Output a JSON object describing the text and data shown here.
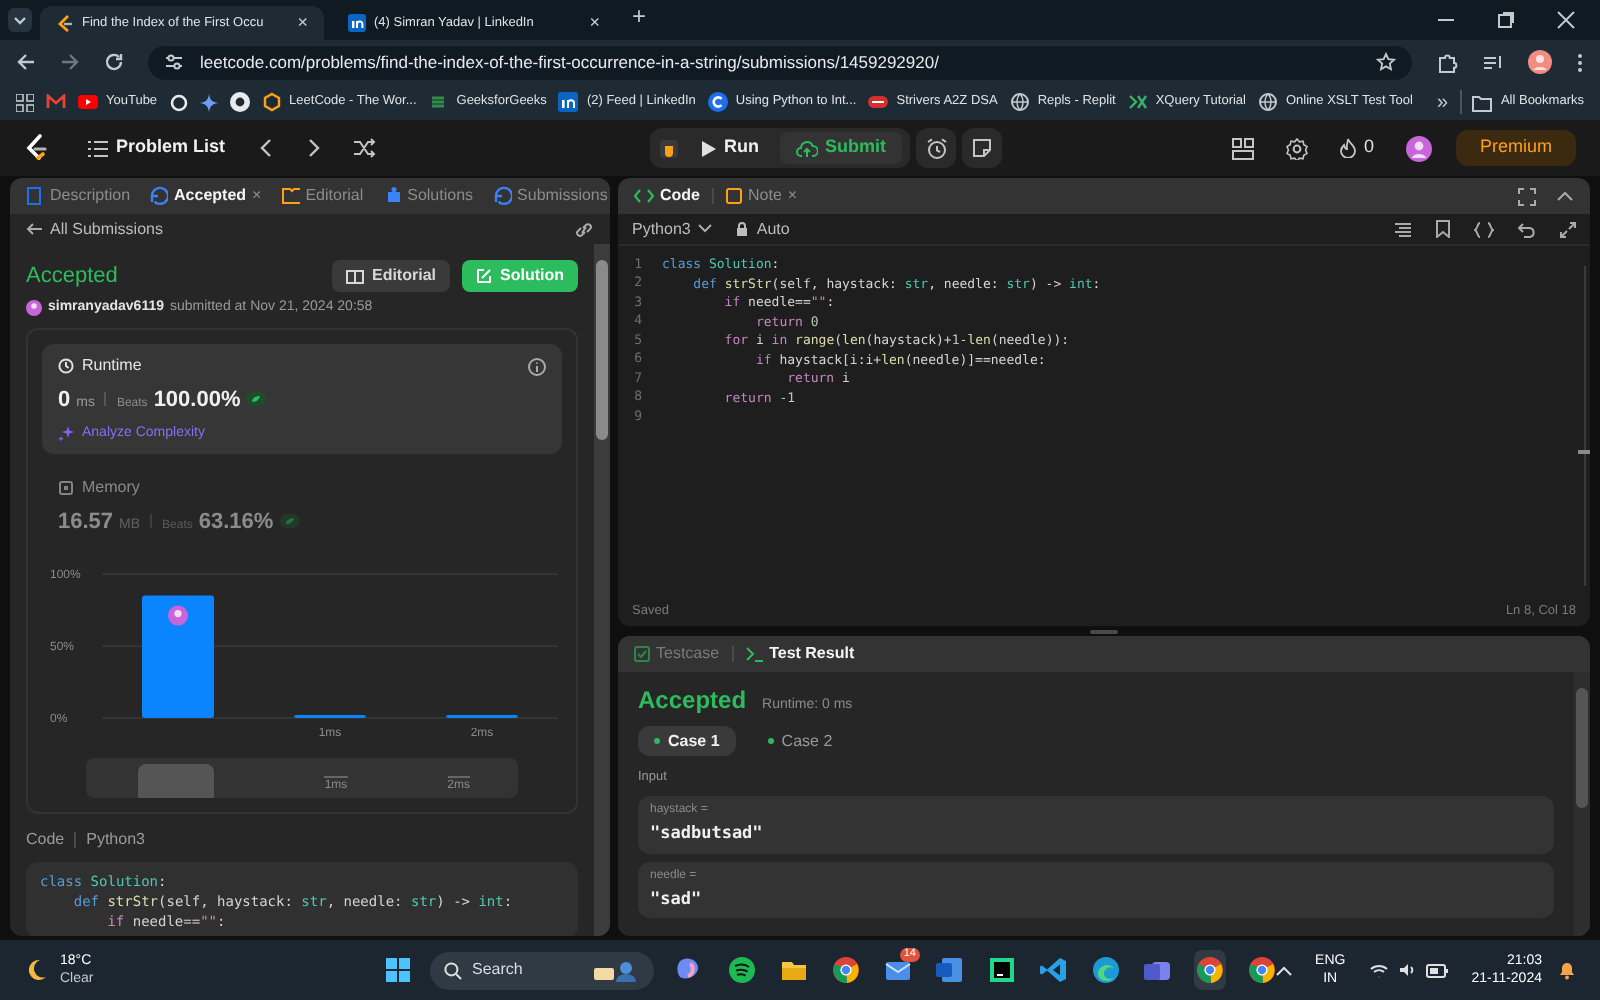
{
  "browser": {
    "tabs": [
      {
        "title": "Find the Index of the First Occu",
        "close": "×",
        "selected": true
      },
      {
        "title": "(4) Simran Yadav | LinkedIn",
        "close": "×",
        "selected": false
      }
    ],
    "new_tab": "+",
    "url": "leetcode.com/problems/find-the-index-of-the-first-occurrence-in-a-string/submissions/1459292920/",
    "bookmarks": [
      {
        "label": "YouTube"
      },
      {
        "label": "LeetCode - The Wor..."
      },
      {
        "label": "GeeksforGeeks"
      },
      {
        "label": "(2) Feed | LinkedIn"
      },
      {
        "label": "Using Python to Int..."
      },
      {
        "label": "Strivers A2Z DSA"
      },
      {
        "label": "Repls - Replit"
      },
      {
        "label": "XQuery Tutorial"
      },
      {
        "label": "Online XSLT Test Tool"
      }
    ],
    "more": "»",
    "all_bookmarks": "All Bookmarks"
  },
  "nav": {
    "problem_list": "Problem List",
    "run": "Run",
    "submit": "Submit",
    "streak": "0",
    "premium": "Premium"
  },
  "left_panel": {
    "tabs": [
      {
        "label": "Description",
        "selected": false
      },
      {
        "label": "Accepted",
        "close": "×",
        "selected": true
      },
      {
        "label": "Editorial",
        "selected": false
      },
      {
        "label": "Solutions",
        "selected": false
      },
      {
        "label": "Submissions",
        "selected": false
      }
    ],
    "back": "All Submissions",
    "status": "Accepted",
    "user": "simranyadav6119",
    "submitted": "submitted at Nov 21, 2024 20:58",
    "buttons": [
      {
        "label": "Editorial",
        "kind": "secondary"
      },
      {
        "label": "Solution",
        "kind": "primary"
      }
    ],
    "metrics": [
      {
        "title": "Runtime",
        "value": "0",
        "unit": "ms",
        "beats_label": "Beats",
        "beats": "100.00%",
        "analyze": "Analyze Complexity",
        "selected": true
      },
      {
        "title": "Memory",
        "value": "16.57",
        "unit": "MB",
        "beats_label": "Beats",
        "beats": "63.16%",
        "selected": false
      }
    ],
    "chart_data": {
      "type": "bar",
      "categories": [
        null,
        "1ms",
        "2ms"
      ],
      "values": [
        85,
        2,
        2
      ],
      "ylim": [
        0,
        100
      ],
      "yticks": [
        {
          "value": 0,
          "label": "0%"
        },
        {
          "value": 50,
          "label": "50%"
        },
        {
          "value": 100,
          "label": "100%"
        }
      ]
    },
    "navigator_labels": [
      "1ms",
      "2ms"
    ],
    "code_label": "Code",
    "language": "Python3",
    "code_preview": [
      [
        {
          "text": "class ",
          "kind": "keyword"
        },
        {
          "text": "Solution",
          "kind": "type"
        },
        {
          "text": ":",
          "kind": "plain"
        }
      ],
      [
        {
          "text": "    def ",
          "kind": "keyword"
        },
        {
          "text": "strStr",
          "kind": "function"
        },
        {
          "text": "(self, haystack: ",
          "kind": "plain"
        },
        {
          "text": "str",
          "kind": "type"
        },
        {
          "text": ", needle: ",
          "kind": "plain"
        },
        {
          "text": "str",
          "kind": "type"
        },
        {
          "text": ") -> ",
          "kind": "plain"
        },
        {
          "text": "int",
          "kind": "type"
        },
        {
          "text": ":",
          "kind": "plain"
        }
      ],
      [
        {
          "text": "        if ",
          "kind": "control"
        },
        {
          "text": "needle==",
          "kind": "plain"
        },
        {
          "text": "\"\"",
          "kind": "string"
        },
        {
          "text": ":",
          "kind": "plain"
        }
      ]
    ]
  },
  "editor": {
    "tabs": [
      {
        "label": "Code",
        "selected": true
      },
      {
        "label": "Note",
        "close": "×",
        "selected": false
      }
    ],
    "language": "Python3",
    "mode": "Auto",
    "lines": [
      {
        "n": "1",
        "tokens": [
          {
            "text": "class ",
            "kind": "keyword"
          },
          {
            "text": "Solution",
            "kind": "type"
          },
          {
            "text": ":",
            "kind": "plain"
          }
        ]
      },
      {
        "n": "2",
        "tokens": [
          {
            "text": "    def ",
            "kind": "keyword"
          },
          {
            "text": "strStr",
            "kind": "function"
          },
          {
            "text": "(self, haystack: ",
            "kind": "plain"
          },
          {
            "text": "str",
            "kind": "type"
          },
          {
            "text": ", needle: ",
            "kind": "plain"
          },
          {
            "text": "str",
            "kind": "type"
          },
          {
            "text": ") -> ",
            "kind": "plain"
          },
          {
            "text": "int",
            "kind": "type"
          },
          {
            "text": ":",
            "kind": "plain"
          }
        ]
      },
      {
        "n": "3",
        "tokens": [
          {
            "text": "        if ",
            "kind": "control"
          },
          {
            "text": "needle==",
            "kind": "plain"
          },
          {
            "text": "\"\"",
            "kind": "string"
          },
          {
            "text": ":",
            "kind": "plain"
          }
        ]
      },
      {
        "n": "4",
        "tokens": [
          {
            "text": "            return ",
            "kind": "control"
          },
          {
            "text": "0",
            "kind": "number"
          }
        ]
      },
      {
        "n": "5",
        "tokens": [
          {
            "text": "        for ",
            "kind": "control"
          },
          {
            "text": "i ",
            "kind": "plain"
          },
          {
            "text": "in ",
            "kind": "control"
          },
          {
            "text": "range",
            "kind": "function"
          },
          {
            "text": "(",
            "kind": "plain"
          },
          {
            "text": "len",
            "kind": "function"
          },
          {
            "text": "(haystack)+",
            "kind": "plain"
          },
          {
            "text": "1",
            "kind": "number"
          },
          {
            "text": "-",
            "kind": "plain"
          },
          {
            "text": "len",
            "kind": "function"
          },
          {
            "text": "(needle)):",
            "kind": "plain"
          }
        ]
      },
      {
        "n": "6",
        "tokens": [
          {
            "text": "            if ",
            "kind": "control"
          },
          {
            "text": "haystack[i:i+",
            "kind": "plain"
          },
          {
            "text": "len",
            "kind": "function"
          },
          {
            "text": "(needle)]==needle:",
            "kind": "plain"
          }
        ]
      },
      {
        "n": "7",
        "tokens": [
          {
            "text": "                return ",
            "kind": "control"
          },
          {
            "text": "i",
            "kind": "plain"
          }
        ]
      },
      {
        "n": "8",
        "tokens": [
          {
            "text": "        return ",
            "kind": "control"
          },
          {
            "text": "-1",
            "kind": "number"
          }
        ]
      },
      {
        "n": "9"
      }
    ],
    "saved": "Saved",
    "cursor": "Ln 8, Col 18"
  },
  "test_panel": {
    "tabs": [
      {
        "label": "Testcase",
        "selected": false
      },
      {
        "label": "Test Result",
        "selected": true
      }
    ],
    "status": "Accepted",
    "runtime": "Runtime: 0 ms",
    "cases": [
      {
        "label": "Case 1",
        "selected": true
      },
      {
        "label": "Case 2",
        "selected": false
      }
    ],
    "input_label": "Input",
    "params": [
      {
        "name": "haystack =",
        "value": "\"sadbutsad\""
      },
      {
        "name": "needle =",
        "value": "\"sad\""
      }
    ]
  },
  "taskbar": {
    "temperature": "18°C",
    "weather": "Clear",
    "search": "Search",
    "mail_badge": "14",
    "language": "ENG",
    "region": "IN",
    "time": "21:03",
    "date": "21-11-2024"
  }
}
